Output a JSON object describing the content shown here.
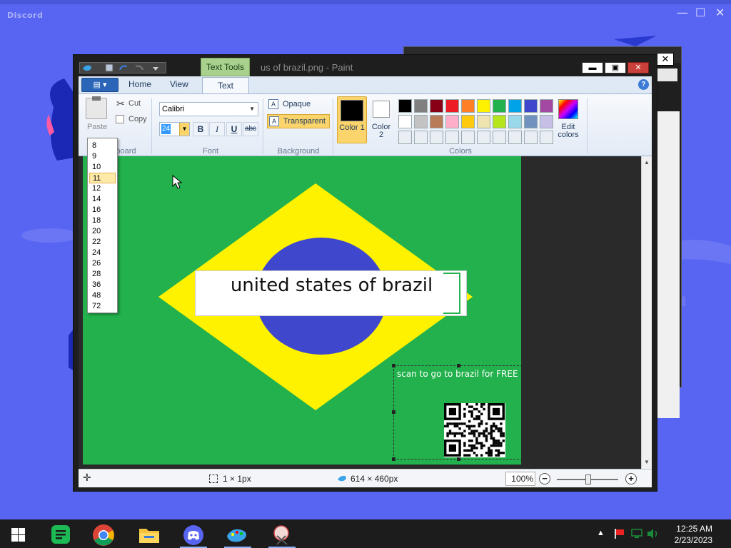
{
  "discord": {
    "brand": "Discord",
    "controls": {
      "minimize": "—",
      "maximize": "☐",
      "close": "✕"
    }
  },
  "back_window": {
    "close_label": "✕"
  },
  "paint": {
    "title": "us of brazil.png - Paint",
    "context_tab": "Text Tools",
    "title_buttons": {
      "minimize": "▬",
      "maximize": "▣",
      "close": "✕"
    },
    "tabs": [
      "Home",
      "View",
      "Text"
    ],
    "active_tab": "Text",
    "help_label": "?",
    "clipboard": {
      "paste_label": "Paste",
      "cut_label": "Cut",
      "copy_label": "Copy",
      "group_label": "Clipboard"
    },
    "font": {
      "family": "Calibri",
      "size": "24",
      "bold": "B",
      "italic": "I",
      "underline": "U",
      "strikethrough": "abc",
      "group_label": "Font"
    },
    "background": {
      "opaque_label": "Opaque",
      "transparent_label": "Transparent",
      "selected": "Transparent",
      "group_label": "Background"
    },
    "colors": {
      "color1_label": "Color 1",
      "color2_label": "Color 2",
      "color1": "#000000",
      "color2": "#ffffff",
      "edit_label": "Edit colors",
      "group_label": "Colors",
      "palette_row1": [
        "#000000",
        "#7f7f7f",
        "#880015",
        "#ed1c24",
        "#ff7f27",
        "#fff200",
        "#22b14c",
        "#00a2e8",
        "#3f48cc",
        "#a349a4"
      ],
      "palette_row2": [
        "#ffffff",
        "#c3c3c3",
        "#b97a57",
        "#ffaec9",
        "#ffc90e",
        "#efe4b0",
        "#b5e61d",
        "#99d9ea",
        "#7092be",
        "#c8bfe7"
      ],
      "palette_row3": [
        "#e9eef5",
        "#e9eef5",
        "#e9eef5",
        "#e9eef5",
        "#e9eef5",
        "#e9eef5",
        "#e9eef5",
        "#e9eef5",
        "#e9eef5",
        "#e9eef5"
      ]
    },
    "font_size_options": [
      "8",
      "9",
      "10",
      "11",
      "12",
      "14",
      "16",
      "18",
      "20",
      "22",
      "24",
      "26",
      "28",
      "36",
      "48",
      "72"
    ],
    "hovered_size": "11",
    "canvas": {
      "text_box": "united states of brazil",
      "qr_caption": "scan to go to brazil for FREE !"
    },
    "status": {
      "selection_size": "1 × 1px",
      "image_size": "614 × 460px",
      "zoom": "100%",
      "zoom_out": "−",
      "zoom_in": "+"
    }
  },
  "taskbar": {
    "apps": [
      "start-button",
      "notes-app",
      "chrome",
      "file-explorer",
      "discord",
      "paint",
      "snipping-tool"
    ],
    "time": "12:25 AM",
    "date": "2/23/2023"
  }
}
